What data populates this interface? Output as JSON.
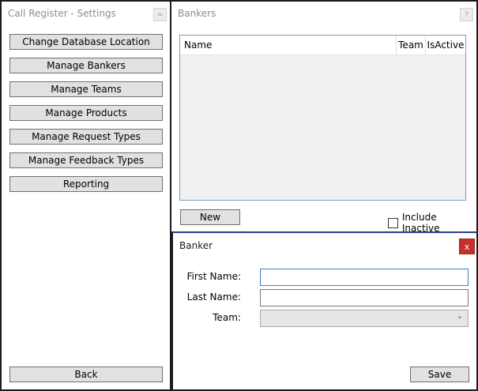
{
  "settings_window": {
    "title": "Call Register - Settings",
    "mini_button": "≈",
    "menu": [
      {
        "label": "Change Database Location"
      },
      {
        "label": "Manage Bankers"
      },
      {
        "label": "Manage Teams"
      },
      {
        "label": "Manage Products"
      },
      {
        "label": "Manage Request Types"
      },
      {
        "label": "Manage Feedback Types"
      },
      {
        "label": "Reporting"
      }
    ],
    "back_label": "Back"
  },
  "bankers_window": {
    "title": "Bankers",
    "mini_button": "?",
    "columns": [
      "Name",
      "Team",
      "IsActive"
    ],
    "rows": [],
    "new_label": "New",
    "include_inactive_label": "Include Inactive",
    "include_inactive_checked": false
  },
  "banker_window": {
    "title": "Banker",
    "close_label": "x",
    "close_color": "#c4302b",
    "fields": {
      "first_name": {
        "label": "First Name:",
        "value": ""
      },
      "last_name": {
        "label": "Last Name:",
        "value": ""
      },
      "team": {
        "label": "Team:",
        "value": ""
      }
    },
    "save_label": "Save"
  }
}
